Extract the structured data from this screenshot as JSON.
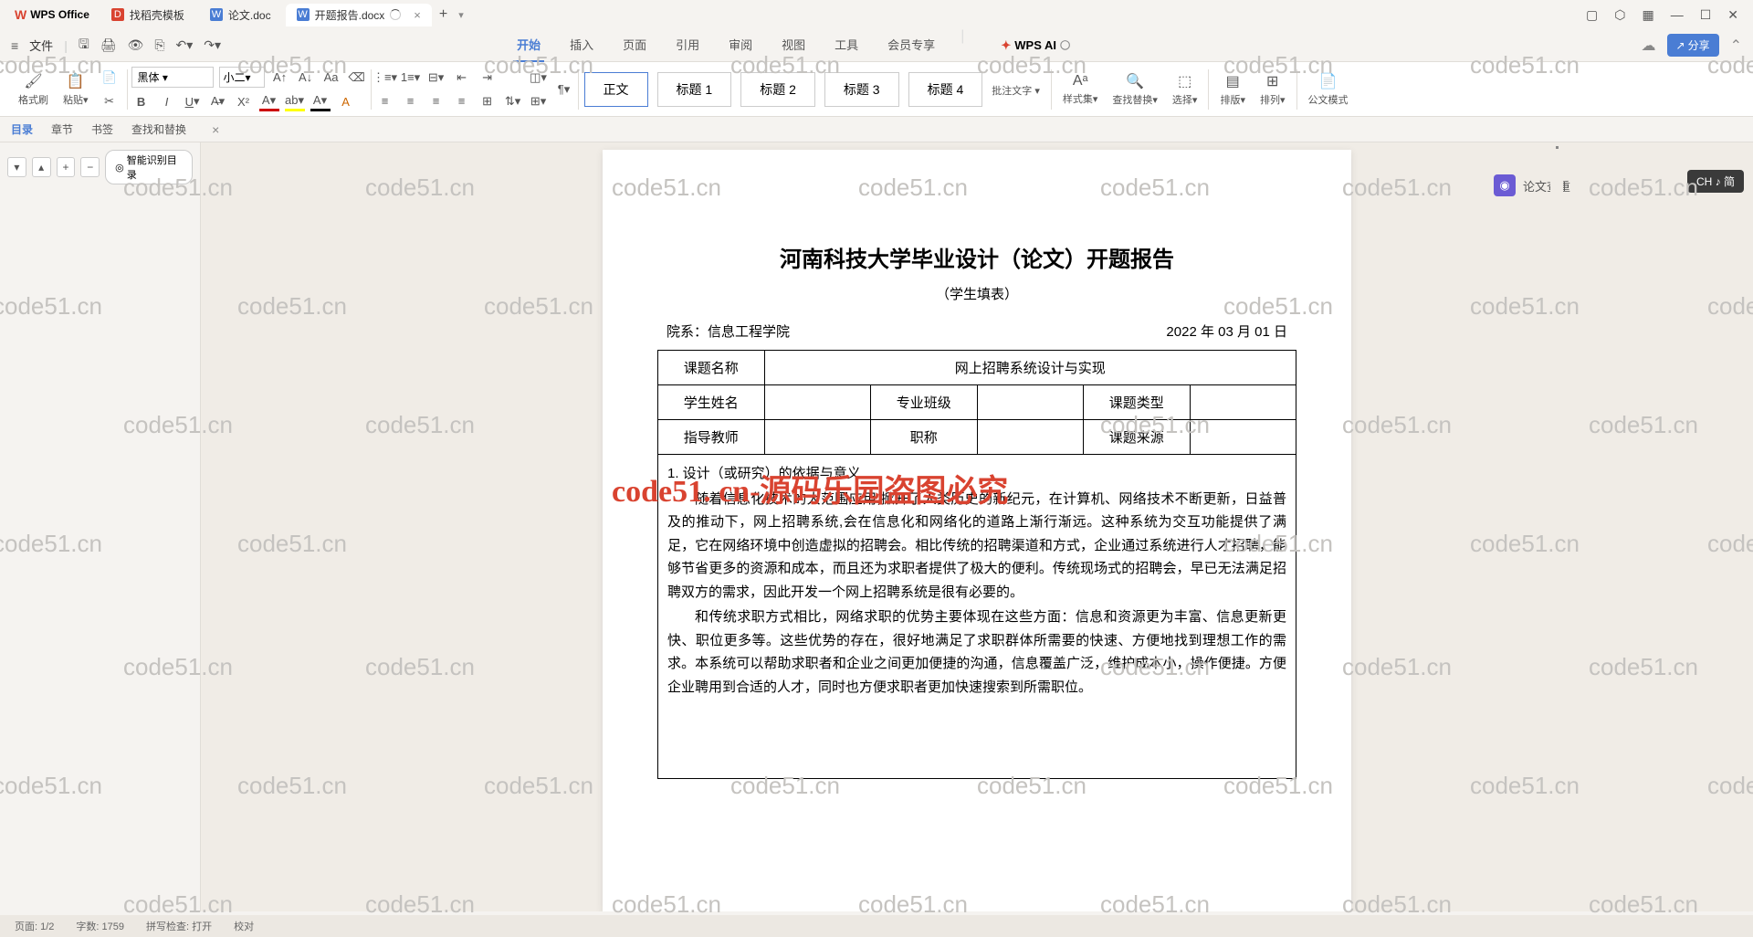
{
  "app": {
    "name": "WPS Office"
  },
  "tabs": [
    {
      "label": "找稻壳模板",
      "icon": "red"
    },
    {
      "label": "论文.doc",
      "icon": "blue"
    },
    {
      "label": "开题报告.docx",
      "icon": "blue",
      "active": true,
      "loading": true
    }
  ],
  "menus": {
    "file": "文件",
    "items": [
      "开始",
      "插入",
      "页面",
      "引用",
      "审阅",
      "视图",
      "工具",
      "会员专享"
    ],
    "ai": "WPS AI"
  },
  "ribbon": {
    "format_painter": "格式刷",
    "paste": "粘贴",
    "font": "黑体",
    "size": "小二",
    "styles": [
      "正文",
      "标题 1",
      "标题 2",
      "标题 3",
      "标题 4"
    ],
    "annotate": "批注文字",
    "style_set": "样式集",
    "find_replace": "查找替换",
    "select": "选择",
    "layout": "排版",
    "arrange": "排列",
    "official": "公文模式"
  },
  "nav": {
    "items": [
      "目录",
      "章节",
      "书签",
      "查找和替换"
    ],
    "smart": "智能识别目录"
  },
  "right": {
    "check": "论文查重",
    "ime": "CH ♪ 简",
    "share": "分享"
  },
  "doc": {
    "title": "河南科技大学毕业设计（论文）开题报告",
    "subtitle": "（学生填表）",
    "dept_label": "院系：",
    "dept": "信息工程学院",
    "date": "2022 年 03 月 01 日",
    "r1_label": "课题名称",
    "r1_val": "网上招聘系统设计与实现",
    "r2_l1": "学生姓名",
    "r2_l2": "专业班级",
    "r2_l3": "课题类型",
    "r3_l1": "指导教师",
    "r3_l2": "职称",
    "r3_l3": "课题来源",
    "sec_head": "1. 设计（或研究）的依据与意义",
    "p1": "随着信息化技术的大范围应用,掀开了人类历史的新纪元，在计算机、网络技术不断更新，日益普及的推动下，网上招聘系统,会在信息化和网络化的道路上渐行渐远。这种系统为交互功能提供了满足，它在网络环境中创造虚拟的招聘会。相比传统的招聘渠道和方式，企业通过系统进行人才招聘，能够节省更多的资源和成本，而且还为求职者提供了极大的便利。传统现场式的招聘会，早已无法满足招聘双方的需求，因此开发一个网上招聘系统是很有必要的。",
    "p2": "和传统求职方式相比，网络求职的优势主要体现在这些方面：信息和资源更为丰富、信息更新更快、职位更多等。这些优势的存在，很好地满足了求职群体所需要的快速、方便地找到理想工作的需求。本系统可以帮助求职者和企业之间更加便捷的沟通，信息覆盖广泛，维护成本小，操作便捷。方便企业聘用到合适的人才，同时也方便求职者更加快速搜索到所需职位。"
  },
  "wm": "code51.cn",
  "red_wm": "code51. cn-源码乐园盗图必究",
  "status": {
    "page": "页面: 1/2",
    "words": "字数: 1759",
    "spell": "拼写检查: 打开",
    "proof": "校对"
  }
}
